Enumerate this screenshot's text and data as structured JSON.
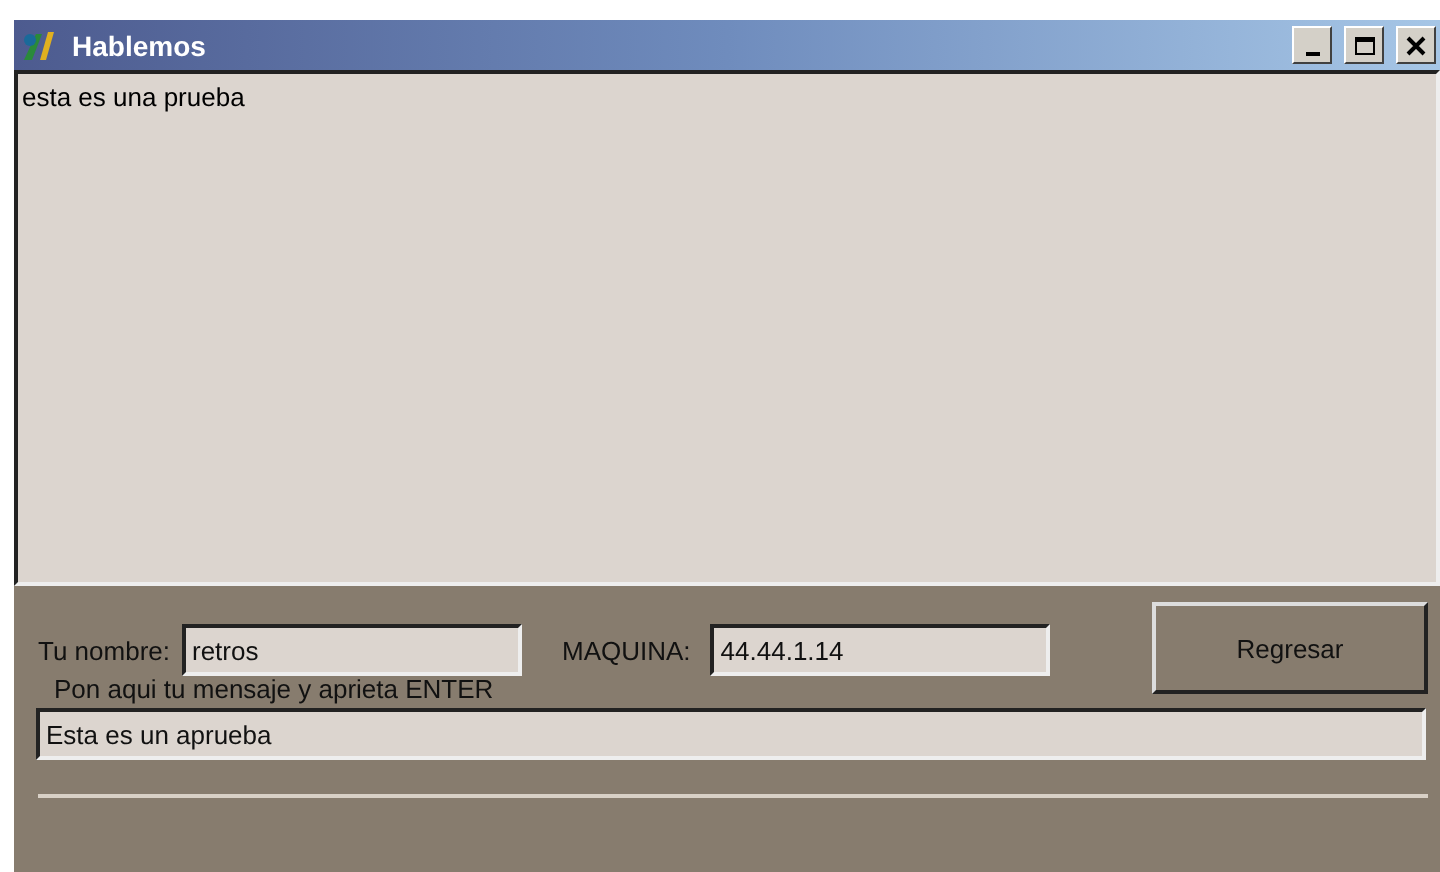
{
  "window": {
    "title": "Hablemos"
  },
  "chat_log": {
    "text": "esta es una prueba"
  },
  "name_field": {
    "label": "Tu nombre:",
    "value": "retros"
  },
  "machine_field": {
    "label": "MAQUINA:",
    "value": "44.44.1.14"
  },
  "back_button": {
    "label": "Regresar"
  },
  "message_hint": "Pon aqui tu mensaje y aprieta ENTER",
  "message_field": {
    "value": "Esta es un aprueba"
  }
}
